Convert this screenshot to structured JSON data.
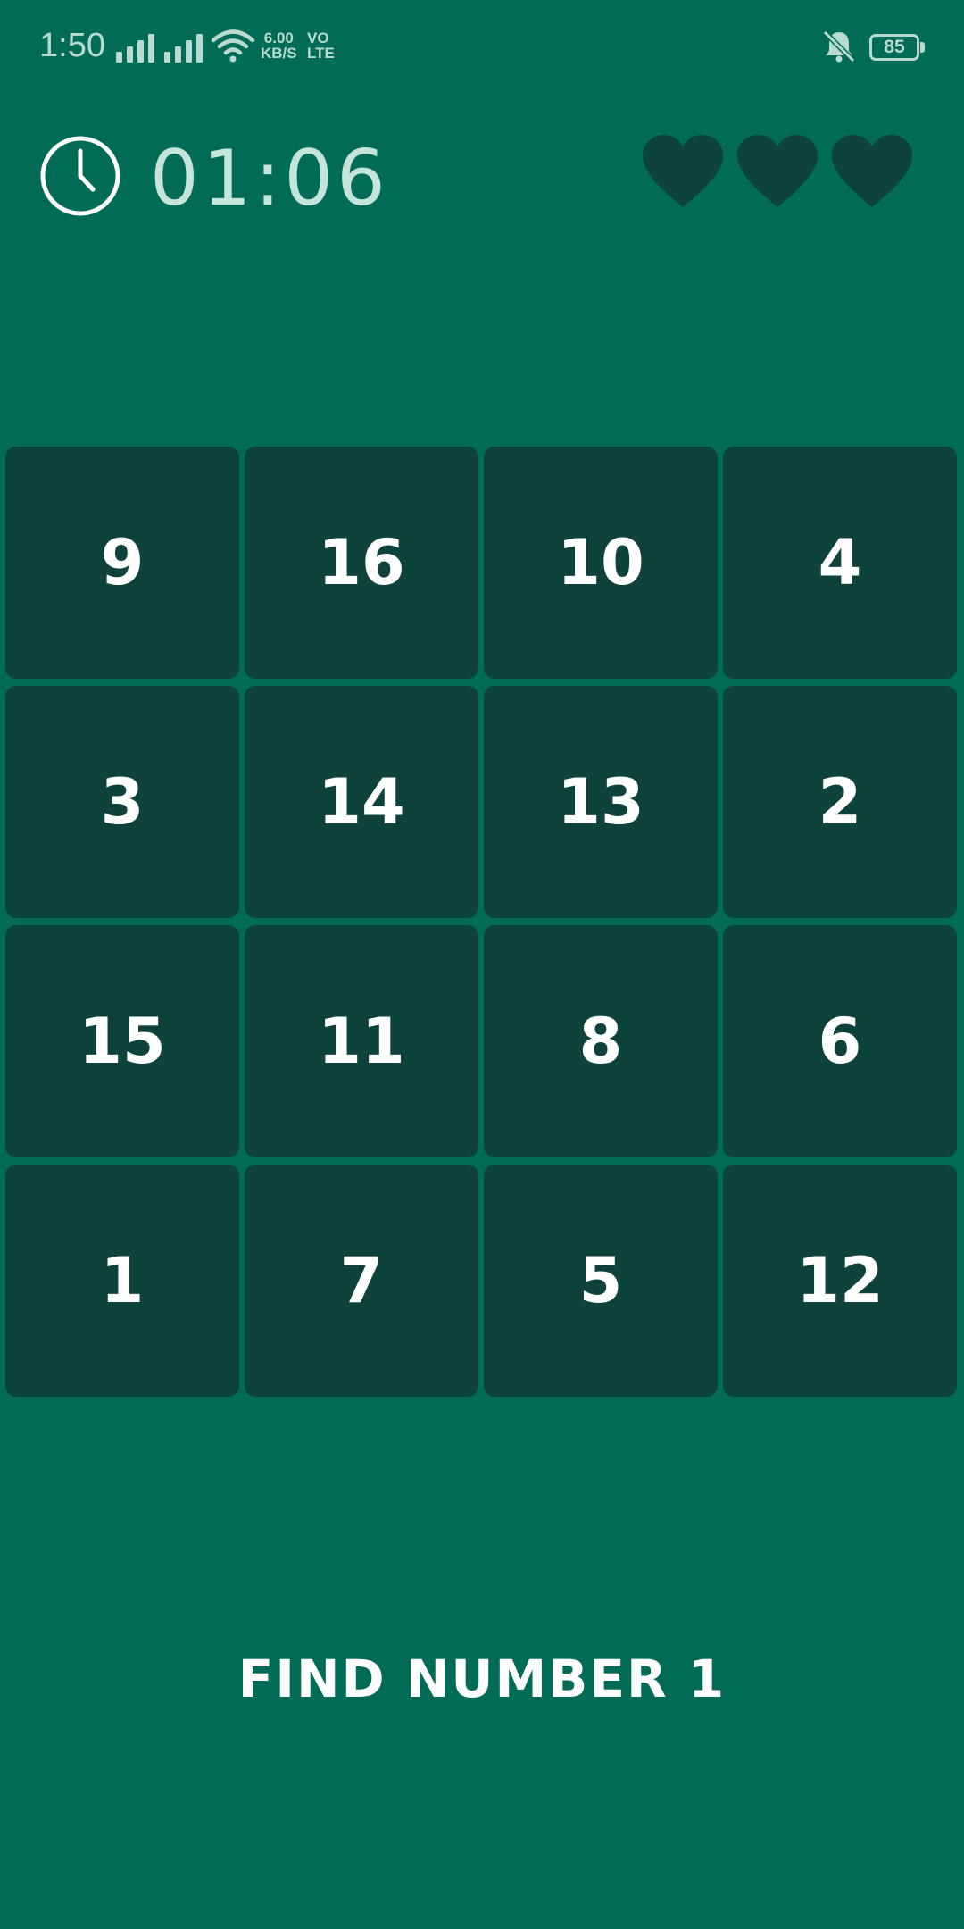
{
  "status_bar": {
    "time": "1:50",
    "network_speed_value": "6.00",
    "network_speed_unit": "KB/S",
    "volte_line1": "VO",
    "volte_line2": "LTE",
    "battery": "85",
    "icons": [
      "signal-icon",
      "signal-icon",
      "wifi-icon",
      "mute-icon",
      "battery-icon"
    ]
  },
  "game": {
    "timer": "01:06",
    "lives": 3,
    "lives_icon": "heart-icon",
    "tiles": [
      9,
      16,
      10,
      4,
      3,
      14,
      13,
      2,
      15,
      11,
      8,
      6,
      1,
      7,
      5,
      12
    ],
    "grid_columns": 4,
    "instruction": "FIND NUMBER 1"
  },
  "colors": {
    "background": "#006b57",
    "tile": "#0d423d",
    "heart": "#0d423d",
    "text": "#ffffff",
    "timer_text": "#c4e4dc"
  }
}
